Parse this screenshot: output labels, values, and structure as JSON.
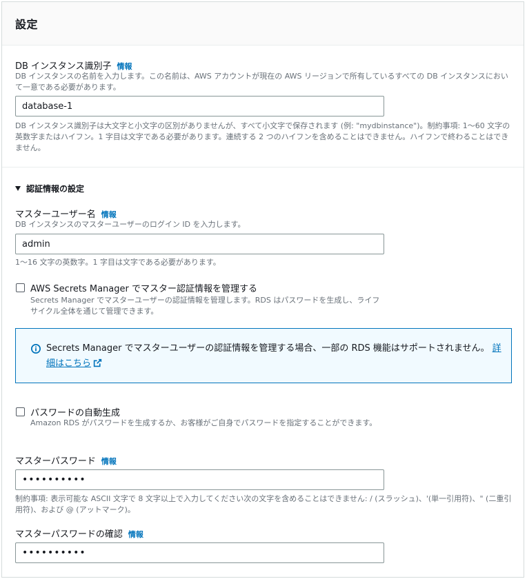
{
  "panel": {
    "title": "設定"
  },
  "db_identifier": {
    "label": "DB インスタンス識別子",
    "info": "情報",
    "description": "DB インスタンスの名前を入力します。この名前は、AWS アカウントが現在の AWS リージョンで所有しているすべての DB インスタンスにおいて一意である必要があります。",
    "value": "database-1",
    "constraint": "DB インスタンス識別子は大文字と小文字の区別がありませんが、すべて小文字で保存されます (例: \"mydbinstance\")。制約事項: 1〜60 文字の英数字またはハイフン。1 字目は文字である必要があります。連続する 2 つのハイフンを含めることはできません。ハイフンで終わることはできません。"
  },
  "credentials": {
    "section_title": "認証情報の設定",
    "username": {
      "label": "マスターユーザー名",
      "info": "情報",
      "description": "DB インスタンスのマスターユーザーのログイン ID を入力します。",
      "value": "admin",
      "constraint": "1〜16 文字の英数字。1 字目は文字である必要があります。"
    },
    "secrets_manager": {
      "label": "AWS Secrets Manager でマスター認証情報を管理する",
      "description": "Secrets Manager でマスターユーザーの認証情報を管理します。RDS はパスワードを生成し、ライフサイクル全体を通じて管理できます。",
      "checked": false
    },
    "alert": {
      "text": "Secrets Manager でマスターユーザーの認証情報を管理する場合、一部の RDS 機能はサポートされません。",
      "link": "詳細はこちら"
    },
    "auto_password": {
      "label": "パスワードの自動生成",
      "description": "Amazon RDS がパスワードを生成するか、お客様がご自身でパスワードを指定することができます。",
      "checked": false
    },
    "master_password": {
      "label": "マスターパスワード",
      "info": "情報",
      "value": "••••••••••",
      "constraint": "制約事項: 表示可能な ASCII 文字で 8 文字以上で入力してください次の文字を含めることはできません: / (スラッシュ)、'(単一引用符)、\" (二重引用符)、および @ (アットマーク)。"
    },
    "confirm_password": {
      "label": "マスターパスワードの確認",
      "info": "情報",
      "value": "••••••••••"
    }
  },
  "colors": {
    "link": "#0073bb",
    "alert_border": "#0073bb",
    "alert_bg": "#f1faff"
  },
  "icons": {
    "alert": "info-circle-icon",
    "external": "external-link-icon",
    "section": "caret-down-icon"
  }
}
